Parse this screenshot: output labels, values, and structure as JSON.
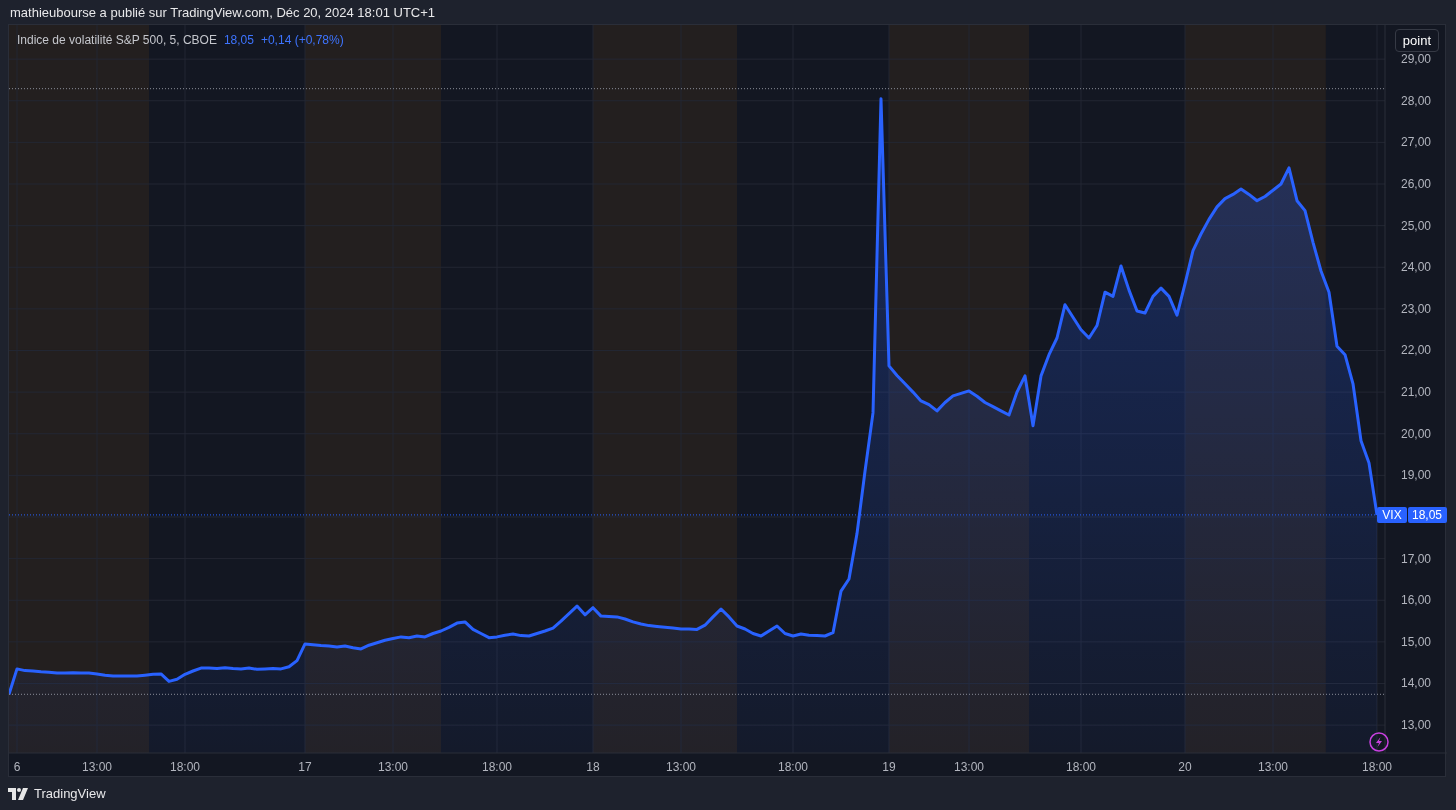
{
  "header": {
    "attribution": "mathieubourse a publié sur TradingView.com, Déc 20, 2024 18:01 UTC+1"
  },
  "legend": {
    "title": "Indice de volatilité S&P 500, 5, CBOE",
    "value": "18,05",
    "change": "+0,14 (+0,78%)"
  },
  "scale_button": "point",
  "price_label": {
    "value": "18,05"
  },
  "alert_icon": {
    "color": "#c840e0"
  },
  "chart_data": {
    "type": "area",
    "categories": [
      null,
      "6",
      null,
      null,
      null,
      null,
      null,
      null,
      null,
      null,
      null,
      "13:00",
      null,
      null,
      null,
      null,
      null,
      null,
      null,
      null,
      null,
      null,
      "18:00",
      null,
      null,
      null,
      null,
      null,
      null,
      null,
      null,
      null,
      null,
      null,
      null,
      null,
      null,
      "17",
      null,
      null,
      null,
      null,
      null,
      null,
      null,
      null,
      null,
      null,
      "13:00",
      null,
      null,
      null,
      null,
      null,
      null,
      null,
      null,
      null,
      null,
      null,
      null,
      "18:00",
      null,
      null,
      null,
      null,
      null,
      null,
      null,
      null,
      null,
      null,
      null,
      "18",
      null,
      null,
      null,
      null,
      null,
      null,
      null,
      null,
      null,
      null,
      "13:00",
      null,
      null,
      null,
      null,
      null,
      null,
      null,
      null,
      null,
      null,
      null,
      null,
      null,
      "18:00",
      null,
      null,
      null,
      null,
      null,
      null,
      null,
      null,
      null,
      null,
      null,
      "19",
      null,
      null,
      null,
      null,
      null,
      null,
      null,
      null,
      null,
      "13:00",
      null,
      null,
      null,
      null,
      null,
      null,
      null,
      null,
      null,
      null,
      null,
      null,
      null,
      "18:00",
      null,
      null,
      null,
      null,
      null,
      null,
      null,
      null,
      null,
      null,
      null,
      null,
      "20",
      null,
      null,
      null,
      null,
      null,
      null,
      null,
      null,
      null,
      null,
      "13:00",
      null,
      null,
      null,
      null,
      null,
      null,
      null,
      null,
      null,
      null,
      null,
      null,
      "18:00"
    ],
    "series": [
      {
        "name": "VIX",
        "color": "#2962ff",
        "values": [
          13.74,
          14.35,
          14.31,
          14.3,
          14.28,
          14.27,
          14.25,
          14.25,
          14.26,
          14.25,
          14.25,
          14.23,
          14.2,
          14.18,
          14.18,
          14.18,
          14.18,
          14.2,
          14.22,
          14.23,
          14.05,
          14.1,
          14.22,
          14.3,
          14.37,
          14.37,
          14.36,
          14.38,
          14.36,
          14.35,
          14.37,
          14.34,
          14.35,
          14.36,
          14.35,
          14.4,
          14.55,
          14.95,
          14.93,
          14.91,
          14.9,
          14.88,
          14.9,
          14.86,
          14.83,
          14.92,
          14.98,
          15.04,
          15.08,
          15.12,
          15.1,
          15.14,
          15.12,
          15.2,
          15.26,
          15.35,
          15.45,
          15.48,
          15.3,
          15.2,
          15.1,
          15.12,
          15.16,
          15.19,
          15.15,
          15.14,
          15.2,
          15.26,
          15.33,
          15.5,
          15.68,
          15.86,
          15.65,
          15.82,
          15.62,
          15.61,
          15.6,
          15.55,
          15.48,
          15.43,
          15.39,
          15.37,
          15.35,
          15.33,
          15.31,
          15.31,
          15.3,
          15.4,
          15.6,
          15.79,
          15.6,
          15.38,
          15.31,
          15.2,
          15.14,
          15.26,
          15.38,
          15.2,
          15.14,
          15.19,
          15.16,
          15.15,
          15.14,
          15.22,
          16.22,
          16.51,
          17.6,
          19.1,
          20.5,
          28.05,
          21.63,
          21.4,
          21.2,
          21.0,
          20.79,
          20.7,
          20.55,
          20.75,
          20.91,
          20.97,
          21.03,
          20.9,
          20.75,
          20.65,
          20.55,
          20.45,
          21.0,
          21.39,
          20.19,
          21.39,
          21.9,
          22.3,
          23.1,
          22.8,
          22.5,
          22.3,
          22.6,
          23.4,
          23.3,
          24.03,
          23.45,
          22.95,
          22.9,
          23.3,
          23.5,
          23.3,
          22.85,
          23.6,
          24.4,
          24.8,
          25.15,
          25.45,
          25.65,
          25.75,
          25.88,
          25.75,
          25.6,
          25.7,
          25.85,
          26.0,
          26.39,
          25.6,
          25.36,
          24.6,
          23.91,
          23.4,
          22.1,
          21.9,
          21.2,
          19.83,
          19.3,
          18.05
        ]
      }
    ],
    "ylim": [
      12.33,
      29.82
    ],
    "grid": true,
    "ref_lines": [
      {
        "axis": "y",
        "value": 28.29,
        "color": "#8a8e99"
      },
      {
        "axis": "y",
        "value": 13.74,
        "color": "#8a8e99"
      },
      {
        "axis": "y",
        "value": 18.05,
        "color": "#2962ff"
      }
    ],
    "yticks": [
      {
        "value": 13,
        "label": "13,00"
      },
      {
        "value": 14,
        "label": "14,00"
      },
      {
        "value": 15,
        "label": "15,00"
      },
      {
        "value": 16,
        "label": "16,00"
      },
      {
        "value": 17,
        "label": "17,00"
      },
      {
        "value": 19,
        "label": "19,00"
      },
      {
        "value": 20,
        "label": "20,00"
      },
      {
        "value": 21,
        "label": "21,00"
      },
      {
        "value": 22,
        "label": "22,00"
      },
      {
        "value": 23,
        "label": "23,00"
      },
      {
        "value": 24,
        "label": "24,00"
      },
      {
        "value": 25,
        "label": "25,00"
      },
      {
        "value": 26,
        "label": "26,00"
      },
      {
        "value": 27,
        "label": "27,00"
      },
      {
        "value": 28,
        "label": "28,00"
      },
      {
        "value": 29,
        "label": "29,00"
      }
    ]
  },
  "footer": {
    "brand": "TradingView"
  }
}
